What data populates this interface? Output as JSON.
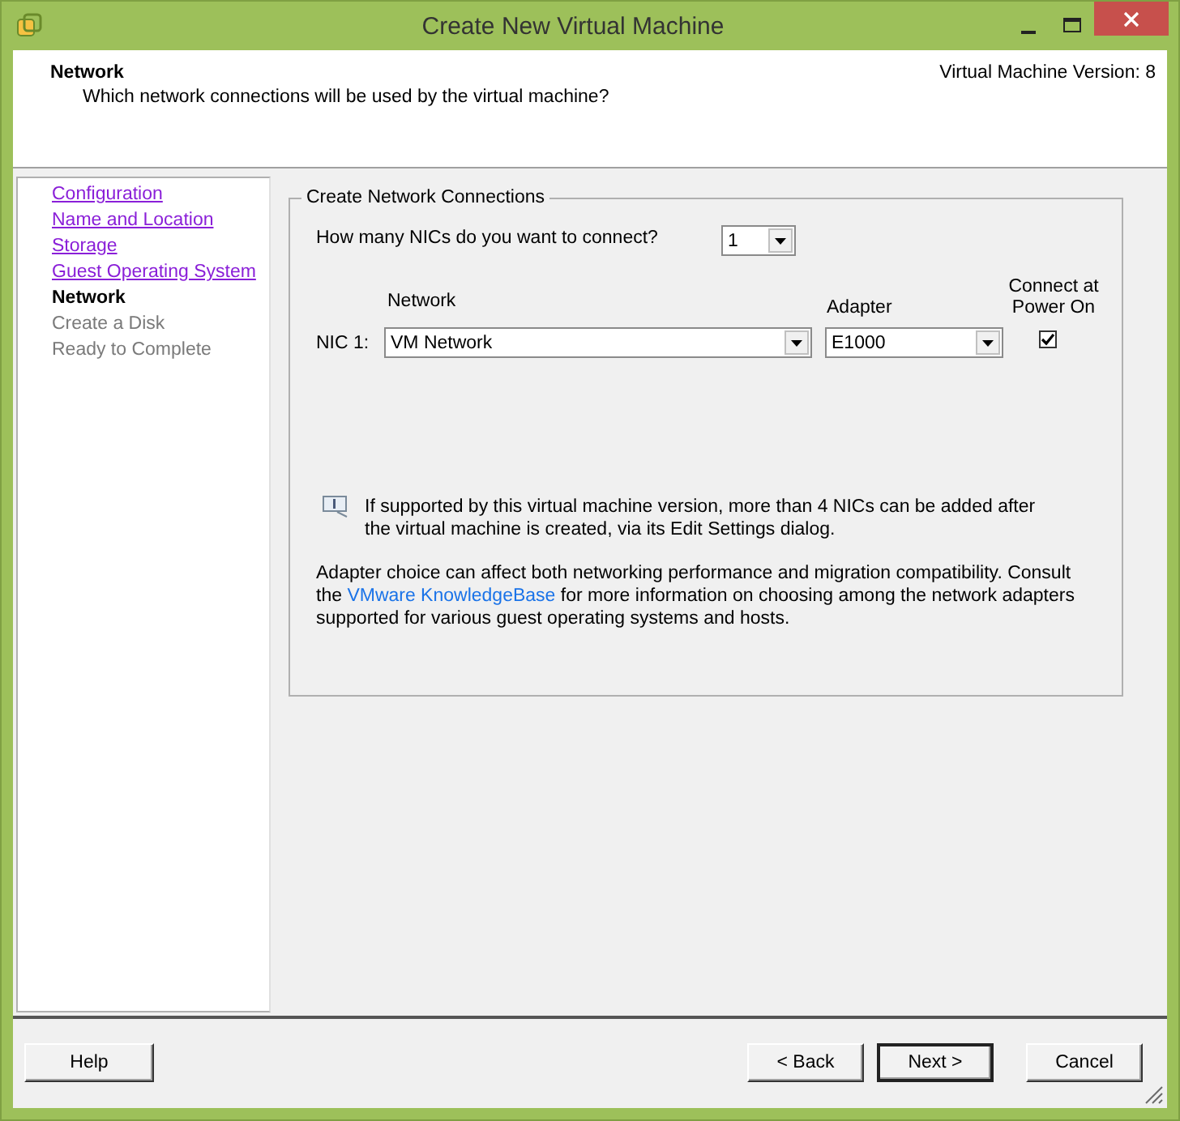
{
  "window": {
    "title": "Create New Virtual Machine"
  },
  "header": {
    "title": "Network",
    "subtitle": "Which network connections will be used by the virtual machine?",
    "version": "Virtual Machine Version: 8"
  },
  "steps": [
    {
      "label": "Configuration",
      "kind": "link"
    },
    {
      "label": "Name and Location",
      "kind": "link"
    },
    {
      "label": "Storage",
      "kind": "link"
    },
    {
      "label": "Guest Operating System",
      "kind": "link"
    },
    {
      "label": "Network",
      "kind": "current"
    },
    {
      "label": "Create a Disk",
      "kind": "disabled"
    },
    {
      "label": "Ready to Complete",
      "kind": "disabled"
    }
  ],
  "group": {
    "title": "Create Network Connections",
    "nic_count_label": "How many NICs do you want to connect?",
    "nic_count": "1",
    "columns": {
      "network": "Network",
      "adapter": "Adapter",
      "connect": "Connect at Power On"
    },
    "nics": [
      {
        "label": "NIC 1:",
        "network": "VM Network",
        "adapter": "E1000",
        "connect": true
      }
    ],
    "info_note": "If supported by this virtual machine version, more than 4 NICs can be added after the virtual machine is created, via its Edit Settings dialog.",
    "adapter_note": {
      "before": "Adapter choice can affect both networking performance and migration compatibility. Consult the",
      "link": "VMware KnowledgeBase",
      "after": "for more information on choosing among the network adapters supported for various guest operating systems and hosts."
    }
  },
  "buttons": [
    {
      "label": "Help",
      "kind": "left",
      "default": false
    },
    {
      "label": "< Back",
      "kind": "right",
      "default": false
    },
    {
      "label": "Next >",
      "kind": "right",
      "default": true
    },
    {
      "label": "Cancel",
      "kind": "right",
      "default": false
    }
  ]
}
